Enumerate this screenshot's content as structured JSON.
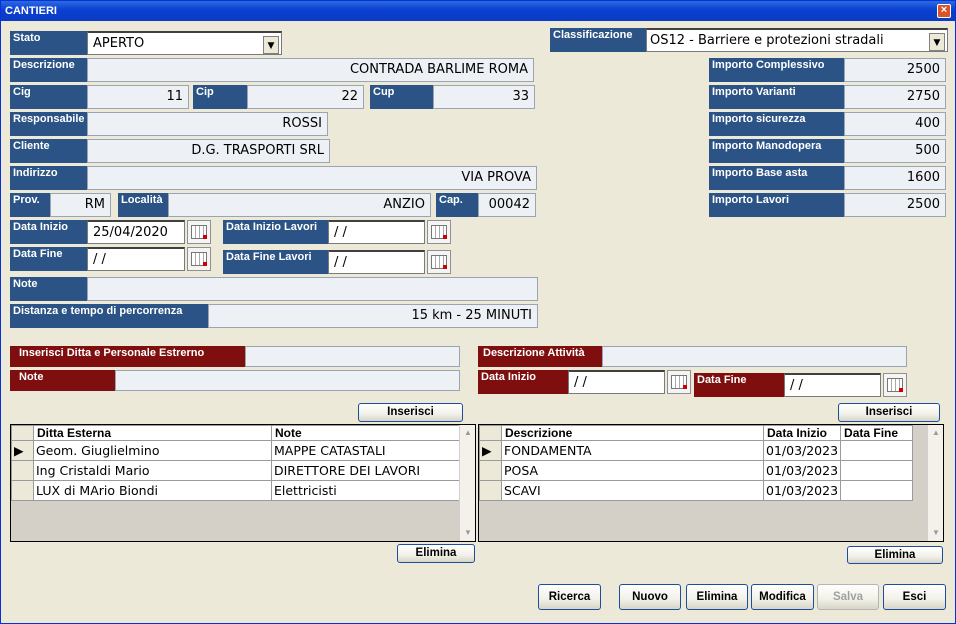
{
  "window": {
    "title": "CANTIERI",
    "close": "×"
  },
  "form": {
    "stato": {
      "label": "Stato",
      "value": "APERTO"
    },
    "descrizione": {
      "label": "Descrizione",
      "value": "CONTRADA BARLIME ROMA"
    },
    "cig": {
      "label": "Cig",
      "value": "11"
    },
    "cip": {
      "label": "Cip",
      "value": "22"
    },
    "cup": {
      "label": "Cup",
      "value": "33"
    },
    "responsabile": {
      "label": "Responsabile",
      "value": "ROSSI"
    },
    "cliente": {
      "label": "Cliente",
      "value": "D.G. TRASPORTI SRL"
    },
    "indirizzo": {
      "label": "Indirizzo",
      "value": "VIA PROVA"
    },
    "prov": {
      "label": "Prov.",
      "value": "RM"
    },
    "localita": {
      "label": "Località",
      "value": "ANZIO"
    },
    "cap": {
      "label": "Cap.",
      "value": "00042"
    },
    "data_inizio": {
      "label": "Data Inizio",
      "value": "25/04/2020"
    },
    "data_inizio_lavori": {
      "label": "Data Inizio Lavori",
      "value": " / /"
    },
    "data_fine": {
      "label": "Data Fine",
      "value": " / /"
    },
    "data_fine_lavori": {
      "label": "Data Fine Lavori",
      "value": " / /"
    },
    "note": {
      "label": "Note",
      "value": ""
    },
    "distanza": {
      "label": "Distanza e tempo di percorrenza",
      "value": "15 km - 25 MINUTI"
    },
    "classificazione": {
      "label": "Classificazione",
      "value": "OS12 - Barriere e protezioni stradali"
    },
    "importi": [
      {
        "label": "Importo Complessivo",
        "value": "2500"
      },
      {
        "label": "Importo Varianti",
        "value": "2750"
      },
      {
        "label": "Importo sicurezza",
        "value": "400"
      },
      {
        "label": "Importo Manodopera",
        "value": "500"
      },
      {
        "label": "Importo Base asta",
        "value": "1600"
      },
      {
        "label": "Importo Lavori",
        "value": "2500"
      }
    ]
  },
  "ditta": {
    "inserisci_label": "Inserisci Ditta e Personale Estrerno",
    "note_label": "Note",
    "inserisci_button": "Inserisci",
    "elimina_button": "Elimina",
    "columns": [
      "Ditta Esterna",
      "Note"
    ],
    "rows": [
      [
        "Geom. Giuglielmino",
        "MAPPE CATASTALI"
      ],
      [
        "Ing Cristaldi Mario",
        "DIRETTORE DEI LAVORI"
      ],
      [
        "LUX di MArio Biondi",
        "Elettricisti"
      ]
    ]
  },
  "attivita": {
    "descrizione_label": "Descrizione Attività",
    "data_inizio_label": "Data Inizio",
    "data_inizio_value": " / /",
    "data_fine_label": "Data Fine",
    "data_fine_value": " / /",
    "inserisci_button": "Inserisci",
    "elimina_button": "Elimina",
    "columns": [
      "Descrizione",
      "Data Inizio",
      "Data Fine"
    ],
    "rows": [
      [
        "FONDAMENTA",
        "01/03/2023",
        ""
      ],
      [
        "POSA",
        "01/03/2023",
        ""
      ],
      [
        "SCAVI",
        "01/03/2023",
        ""
      ]
    ]
  },
  "toolbar": {
    "ricerca": "Ricerca",
    "nuovo": "Nuovo",
    "elimina": "Elimina",
    "modifica": "Modifica",
    "salva": "Salva",
    "esci": "Esci"
  }
}
